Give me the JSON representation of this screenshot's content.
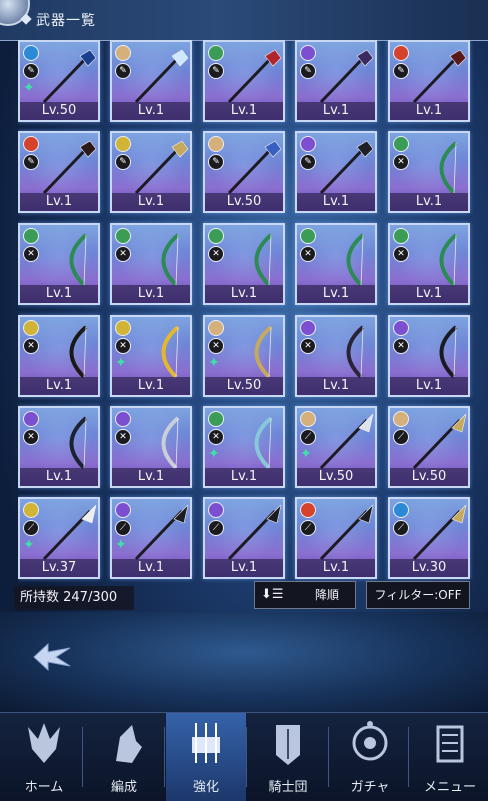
{
  "header": {
    "title": "武器一覧"
  },
  "weapons": [
    {
      "level": "Lv.50",
      "element": "#2b8ad6",
      "weapon_type": "staff",
      "star": true,
      "hue": "#1a3f8f"
    },
    {
      "level": "Lv.1",
      "element": "#d6b07a",
      "weapon_type": "staff",
      "star": false,
      "hue": "#cfe8ff"
    },
    {
      "level": "Lv.1",
      "element": "#3a9c55",
      "weapon_type": "staff",
      "star": false,
      "hue": "#b1262c"
    },
    {
      "level": "Lv.1",
      "element": "#7b4fd0",
      "weapon_type": "staff",
      "star": false,
      "hue": "#3a2a5f"
    },
    {
      "level": "Lv.1",
      "element": "#d6432d",
      "weapon_type": "staff",
      "star": false,
      "hue": "#5a1a1a"
    },
    {
      "level": "Lv.1",
      "element": "#d6432d",
      "weapon_type": "staff",
      "star": false,
      "hue": "#2a1a1a"
    },
    {
      "level": "Lv.1",
      "element": "#d1b336",
      "weapon_type": "staff",
      "star": false,
      "hue": "#c7a95e"
    },
    {
      "level": "Lv.50",
      "element": "#d6b07a",
      "weapon_type": "staff",
      "star": false,
      "hue": "#3a5fc4"
    },
    {
      "level": "Lv.1",
      "element": "#7b4fd0",
      "weapon_type": "staff",
      "star": false,
      "hue": "#1f1f28"
    },
    {
      "level": "Lv.1",
      "element": "#3a9c55",
      "weapon_type": "bow",
      "star": false,
      "hue": "#2c8a55"
    },
    {
      "level": "Lv.1",
      "element": "#3a9c55",
      "weapon_type": "bow",
      "star": false,
      "hue": "#2c8a55"
    },
    {
      "level": "Lv.1",
      "element": "#3a9c55",
      "weapon_type": "bow",
      "star": false,
      "hue": "#2c8a55"
    },
    {
      "level": "Lv.1",
      "element": "#3a9c55",
      "weapon_type": "bow",
      "star": false,
      "hue": "#2c8a55"
    },
    {
      "level": "Lv.1",
      "element": "#3a9c55",
      "weapon_type": "bow",
      "star": false,
      "hue": "#2c8a55"
    },
    {
      "level": "Lv.1",
      "element": "#3a9c55",
      "weapon_type": "bow",
      "star": false,
      "hue": "#2c8a55"
    },
    {
      "level": "Lv.1",
      "element": "#d1b336",
      "weapon_type": "bow",
      "star": false,
      "hue": "#1a1a14"
    },
    {
      "level": "Lv.1",
      "element": "#d1b336",
      "weapon_type": "bow",
      "star": true,
      "hue": "#e4b82a"
    },
    {
      "level": "Lv.50",
      "element": "#d6b07a",
      "weapon_type": "bow",
      "star": true,
      "hue": "#c7a95e"
    },
    {
      "level": "Lv.1",
      "element": "#7b4fd0",
      "weapon_type": "bow",
      "star": false,
      "hue": "#2a2236"
    },
    {
      "level": "Lv.1",
      "element": "#7b4fd0",
      "weapon_type": "bow",
      "star": false,
      "hue": "#1a1a22"
    },
    {
      "level": "Lv.1",
      "element": "#7b4fd0",
      "weapon_type": "bow",
      "star": false,
      "hue": "#1b2230"
    },
    {
      "level": "Lv.1",
      "element": "#7b4fd0",
      "weapon_type": "bow",
      "star": false,
      "hue": "#c9cfd9"
    },
    {
      "level": "Lv.1",
      "element": "#3a9c55",
      "weapon_type": "bow",
      "star": true,
      "hue": "#86c9d6"
    },
    {
      "level": "Lv.50",
      "element": "#d6b07a",
      "weapon_type": "spear",
      "star": true,
      "hue": "#dde3ec"
    },
    {
      "level": "Lv.50",
      "element": "#d6b07a",
      "weapon_type": "spear",
      "star": false,
      "hue": "#c7a95e"
    },
    {
      "level": "Lv.37",
      "element": "#d1b336",
      "weapon_type": "spear",
      "star": true,
      "hue": "#eeeeee"
    },
    {
      "level": "Lv.1",
      "element": "#7b4fd0",
      "weapon_type": "spear",
      "star": true,
      "hue": "#1c1c22"
    },
    {
      "level": "Lv.1",
      "element": "#7b4fd0",
      "weapon_type": "spear",
      "star": false,
      "hue": "#1c1c22"
    },
    {
      "level": "Lv.1",
      "element": "#d6432d",
      "weapon_type": "spear",
      "star": false,
      "hue": "#1c1c22"
    },
    {
      "level": "Lv.30",
      "element": "#2b8ad6",
      "weapon_type": "spear",
      "star": false,
      "hue": "#c7a95e"
    }
  ],
  "footer": {
    "count_label": "所持数 247/300",
    "sort_label": "降順",
    "filter_label": "フィルター:OFF"
  },
  "nav": [
    {
      "label": "ホーム",
      "active": false
    },
    {
      "label": "編成",
      "active": false
    },
    {
      "label": "強化",
      "active": true
    },
    {
      "label": "騎士団",
      "active": false
    },
    {
      "label": "ガチャ",
      "active": false
    },
    {
      "label": "メニュー",
      "active": false
    }
  ]
}
